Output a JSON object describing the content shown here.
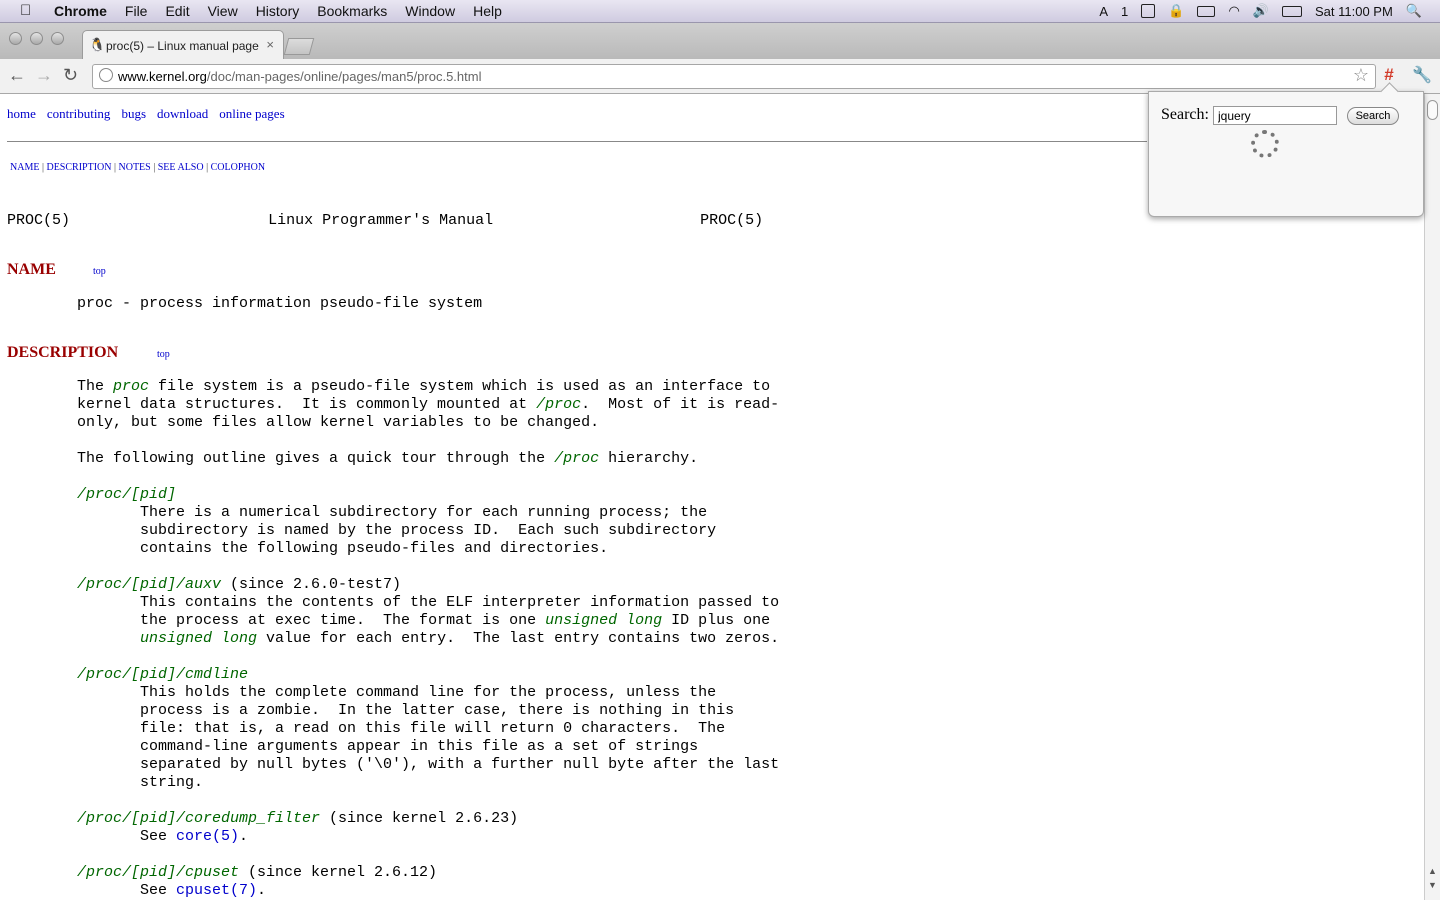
{
  "menubar": {
    "apple": "",
    "items": [
      "Chrome",
      "File",
      "Edit",
      "View",
      "History",
      "Bookmarks",
      "Window",
      "Help"
    ],
    "status": {
      "one": "1",
      "clock": "Sat 11:00 PM"
    }
  },
  "tab": {
    "title": "proc(5) – Linux manual page",
    "close": "×"
  },
  "toolbar": {
    "back": "←",
    "forward": "→",
    "reload": "↻",
    "url_host": "www.kernel.org",
    "url_path": "/doc/man-pages/online/pages/man5/proc.5.html",
    "star": "☆",
    "ext": "#",
    "wrench": "🔧"
  },
  "page": {
    "topnav": [
      "home",
      "contributing",
      "bugs",
      "download",
      "online pages"
    ],
    "sections": [
      "NAME",
      "DESCRIPTION",
      "NOTES",
      "SEE ALSO",
      "COLOPHON"
    ],
    "header": {
      "left": "PROC(5)",
      "center": "Linux Programmer's Manual",
      "right": "PROC(5)"
    },
    "name_heading": "NAME",
    "top": "top",
    "name_text": "proc - process information pseudo-file system",
    "desc_heading": "DESCRIPTION",
    "desc": {
      "p1_a": "The ",
      "p1_proc": "proc",
      "p1_b": " file system is a pseudo-file system which is used as an interface to",
      "p1_c": "kernel data structures.  It is commonly mounted at ",
      "p1_proc2": "/proc",
      "p1_d": ".  Most of it is read-",
      "p1_e": "only, but some files allow kernel variables to be changed.",
      "p2_a": "The following outline gives a quick tour through the ",
      "p2_proc": "/proc",
      "p2_b": " hierarchy.",
      "pid_title": "/proc/[pid]",
      "pid_1": "There is a numerical subdirectory for each running process; the",
      "pid_2": "subdirectory is named by the process ID.  Each such subdirectory",
      "pid_3": "contains the following pseudo-files and directories.",
      "auxv_title": "/proc/[pid]/auxv",
      "auxv_since": " (since 2.6.0-test7)",
      "auxv_1": "This contains the contents of the ELF interpreter information passed to",
      "auxv_2a": "the process at exec time.  The format is one ",
      "auxv_ul": "unsigned long",
      "auxv_2b": " ID plus one",
      "auxv_3a": "unsigned long",
      "auxv_3b": " value for each entry.  The last entry contains two zeros.",
      "cmd_title": "/proc/[pid]/cmdline",
      "cmd_1": "This holds the complete command line for the process, unless the",
      "cmd_2": "process is a zombie.  In the latter case, there is nothing in this",
      "cmd_3": "file: that is, a read on this file will return 0 characters.  The",
      "cmd_4": "command-line arguments appear in this file as a set of strings",
      "cmd_5": "separated by null bytes ('\\0'), with a further null byte after the last",
      "cmd_6": "string.",
      "core_title": "/proc/[pid]/coredump_filter",
      "core_since": " (since kernel 2.6.23)",
      "core_see": "See ",
      "core_link": "core(5)",
      "core_end": ".",
      "cpuset_title": "/proc/[pid]/cpuset",
      "cpuset_since": " (since kernel 2.6.12)",
      "cpuset_see": "See ",
      "cpuset_link": "cpuset(7)",
      "cpuset_end": "."
    }
  },
  "popup": {
    "label": "Search:",
    "value": "jquery",
    "button": "Search"
  },
  "scroll": {
    "up": "▲",
    "down": "▼"
  }
}
